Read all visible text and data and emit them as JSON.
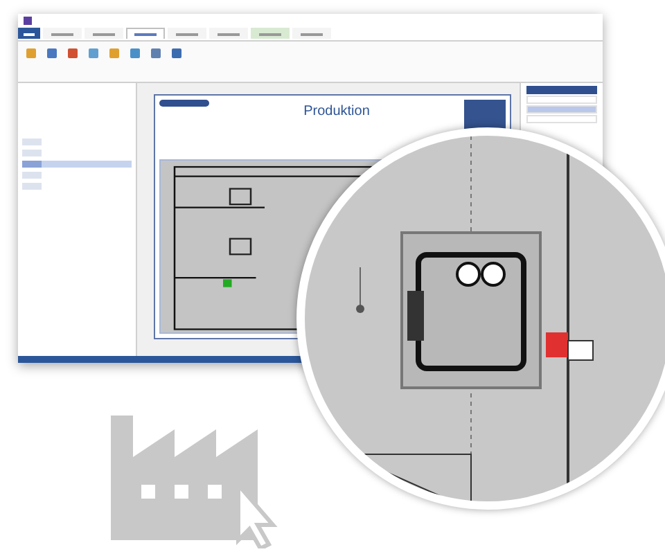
{
  "ribbon": {
    "tabs": [
      {
        "kind": "file",
        "selected": false
      },
      {
        "kind": "tab",
        "selected": false
      },
      {
        "kind": "tab",
        "selected": false
      },
      {
        "kind": "tab",
        "selected": true
      },
      {
        "kind": "tab",
        "selected": false
      },
      {
        "kind": "tab",
        "selected": false
      },
      {
        "kind": "context",
        "selected": false
      },
      {
        "kind": "tab",
        "selected": false
      }
    ]
  },
  "left_panel": {
    "items": [
      {
        "selected": false
      },
      {
        "selected": false
      },
      {
        "selected": true
      },
      {
        "selected": false
      },
      {
        "selected": false
      }
    ]
  },
  "canvas": {
    "title": "Produktion"
  },
  "right_panel": {
    "rows": [
      {
        "selected": false
      },
      {
        "selected": true
      },
      {
        "selected": false
      }
    ]
  }
}
